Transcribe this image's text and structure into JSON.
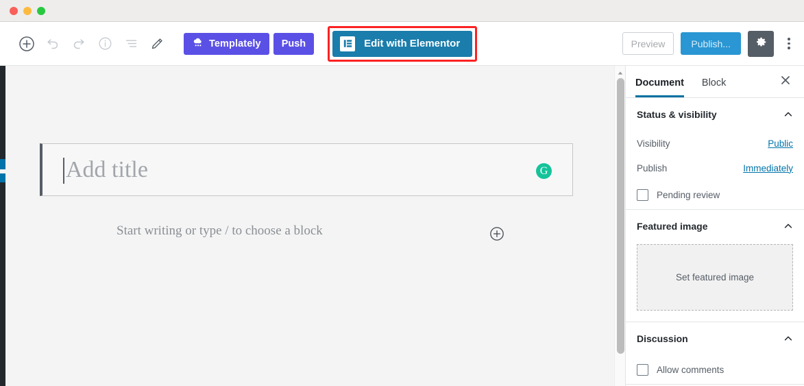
{
  "window": {
    "traffic_lights": [
      "close",
      "minimize",
      "maximize"
    ]
  },
  "toolbar": {
    "icons": [
      {
        "name": "add-block-icon",
        "label": "Add block"
      },
      {
        "name": "undo-icon",
        "label": "Undo"
      },
      {
        "name": "redo-icon",
        "label": "Redo"
      },
      {
        "name": "content-info-icon",
        "label": "Content structure"
      },
      {
        "name": "list-view-icon",
        "label": "Block navigation"
      },
      {
        "name": "pencil-edit-icon",
        "label": "Edit"
      }
    ],
    "templately_label": "Templately",
    "push_label": "Push",
    "elementor_label": "Edit with Elementor",
    "preview_label": "Preview",
    "publish_label": "Publish...",
    "settings_label": "Settings",
    "more_label": "More tools & options"
  },
  "canvas": {
    "title_placeholder": "Add title",
    "title_value": "",
    "grammarly_letter": "G",
    "block_placeholder": "Start writing or type / to choose a block",
    "block_adder_label": "Add block"
  },
  "sidebar": {
    "tabs": [
      {
        "label": "Document",
        "active": true
      },
      {
        "label": "Block",
        "active": false
      }
    ],
    "close_label": "Close settings",
    "panels": [
      {
        "title": "Status & visibility",
        "rows": [
          {
            "label": "Visibility",
            "value": "Public"
          },
          {
            "label": "Publish",
            "value": "Immediately"
          }
        ],
        "checkbox": {
          "label": "Pending review",
          "checked": false
        }
      },
      {
        "title": "Featured image",
        "dropzone_label": "Set featured image"
      },
      {
        "title": "Discussion",
        "checkbox": {
          "label": "Allow comments",
          "checked": false
        }
      }
    ]
  },
  "colors": {
    "templately_purple": "#5b50e6",
    "elementor_blue": "#1a7dab",
    "highlight_red": "#fb2222",
    "publish_blue": "#2a96d3",
    "link_blue": "#0073aa",
    "grammarly_green": "#15c39a",
    "admin_dark": "#23282d",
    "gear_slate": "#555d66"
  }
}
